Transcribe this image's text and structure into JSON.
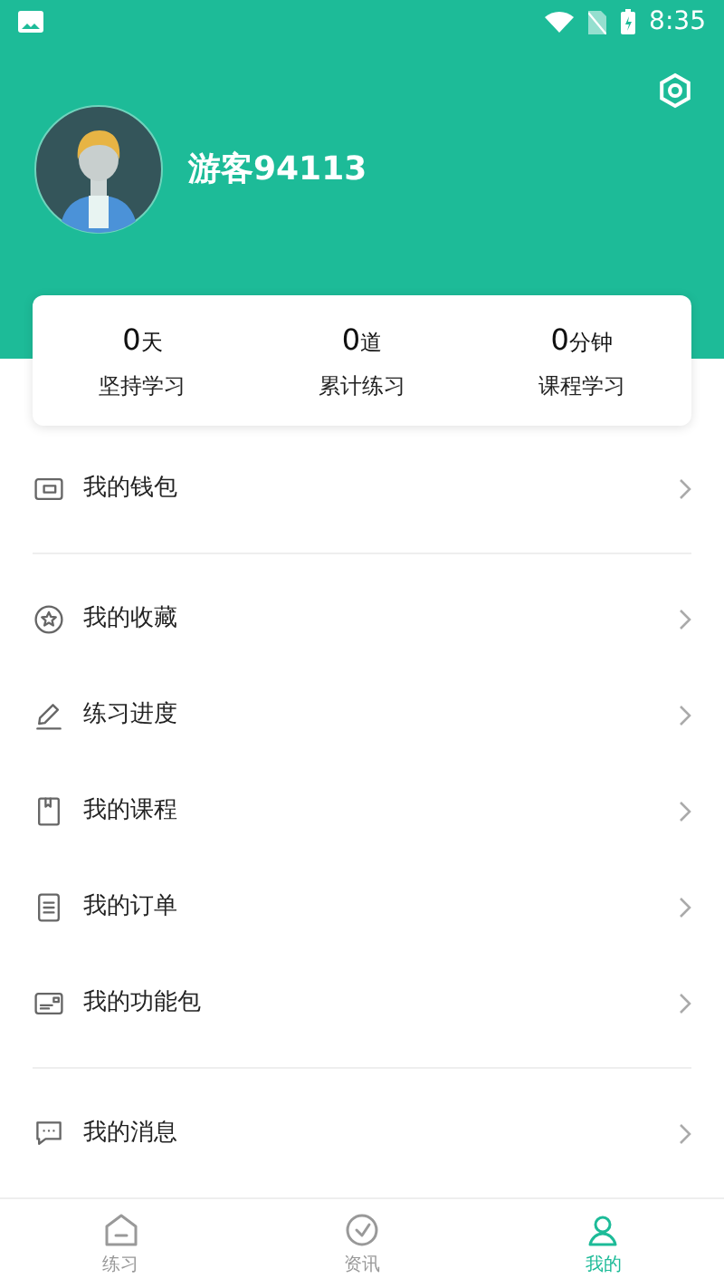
{
  "status_bar": {
    "time": "8:35"
  },
  "profile": {
    "name": "游客94113"
  },
  "stats": [
    {
      "value": "0",
      "unit": "天",
      "label": "坚持学习"
    },
    {
      "value": "0",
      "unit": "道",
      "label": "累计练习"
    },
    {
      "value": "0",
      "unit": "分钟",
      "label": "课程学习"
    }
  ],
  "menu_groups": [
    {
      "items": [
        {
          "label": "我的钱包"
        }
      ]
    },
    {
      "items": [
        {
          "label": "我的收藏"
        },
        {
          "label": "练习进度"
        },
        {
          "label": "我的课程"
        },
        {
          "label": "我的订单"
        },
        {
          "label": "我的功能包"
        }
      ]
    },
    {
      "items": [
        {
          "label": "我的消息"
        }
      ]
    }
  ],
  "tabs": [
    {
      "label": "练习",
      "selected": false
    },
    {
      "label": "资讯",
      "selected": false
    },
    {
      "label": "我的",
      "selected": true
    }
  ]
}
